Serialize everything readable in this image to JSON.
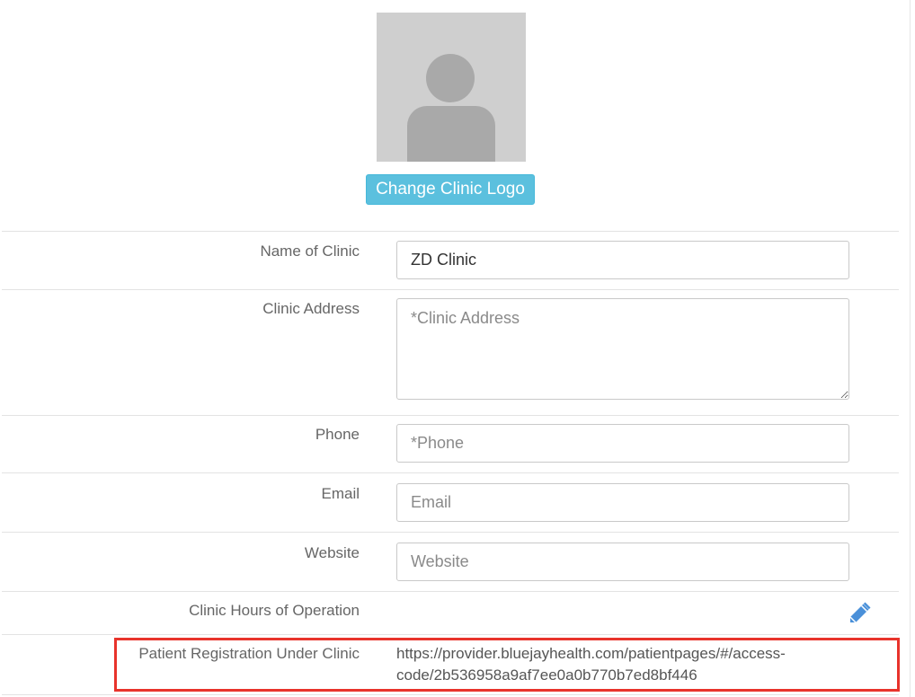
{
  "logo": {
    "change_button_label": "Change Clinic Logo"
  },
  "form": {
    "name": {
      "label": "Name of Clinic",
      "value": "ZD Clinic",
      "placeholder": ""
    },
    "address": {
      "label": "Clinic Address",
      "value": "",
      "placeholder": "*Clinic Address"
    },
    "phone": {
      "label": "Phone",
      "value": "",
      "placeholder": "*Phone"
    },
    "email": {
      "label": "Email",
      "value": "",
      "placeholder": "Email"
    },
    "website": {
      "label": "Website",
      "value": "",
      "placeholder": "Website"
    },
    "hours": {
      "label": "Clinic Hours of Operation",
      "edit_icon": "pencil-icon"
    },
    "registration": {
      "label": "Patient Registration Under Clinic",
      "url_line1": "https://provider.bluejayhealth.com/patientpages/#/access-",
      "url_line2": "code/2b536958a9af7ee0a0b770b7ed8bf446"
    }
  },
  "colors": {
    "button_bg": "#5bc0de",
    "highlight": "#e8332b",
    "pencil": "#4a90d9"
  }
}
